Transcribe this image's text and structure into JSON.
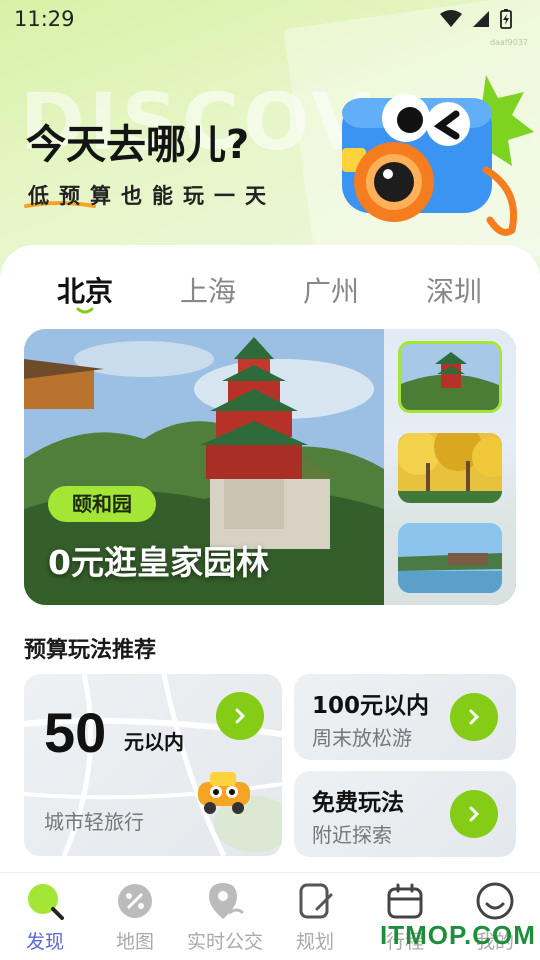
{
  "status_bar": {
    "time": "11:29",
    "device_id": "daaf9037"
  },
  "hero": {
    "watermark": "DISCOV",
    "title": "今天去哪儿?",
    "subtitle": "低预算也能玩一天"
  },
  "city_tabs": [
    {
      "label": "北京",
      "active": true
    },
    {
      "label": "上海",
      "active": false
    },
    {
      "label": "广州",
      "active": false
    },
    {
      "label": "深圳",
      "active": false
    }
  ],
  "banner": {
    "tag": "颐和园",
    "title": "0元逛皇家园林",
    "thumbnails": [
      "pagoda-thumbnail",
      "ginkgo-trees-thumbnail",
      "lake-village-thumbnail"
    ]
  },
  "section": {
    "title": "预算玩法推荐"
  },
  "cards": {
    "big": {
      "number": "50",
      "unit": "元以内",
      "subtitle": "城市轻旅行"
    },
    "small": [
      {
        "title": "100元以内",
        "subtitle": "周末放松游"
      },
      {
        "title": "免费玩法",
        "subtitle": "附近探索"
      }
    ]
  },
  "bottom_nav": [
    {
      "label": "发现",
      "icon": "discover-icon",
      "active": true
    },
    {
      "label": "地图",
      "icon": "map-icon",
      "active": false
    },
    {
      "label": "实时公交",
      "icon": "bus-location-icon",
      "active": false
    },
    {
      "label": "规划",
      "icon": "plan-icon",
      "active": false
    },
    {
      "label": "行程",
      "icon": "calendar-icon",
      "active": false
    },
    {
      "label": "我的",
      "icon": "profile-icon",
      "active": false
    }
  ],
  "site_watermark": "ITMOP.COM",
  "colors": {
    "accent": "#a3e635",
    "button": "#84cc16",
    "nav_active": "#5a67d8"
  }
}
